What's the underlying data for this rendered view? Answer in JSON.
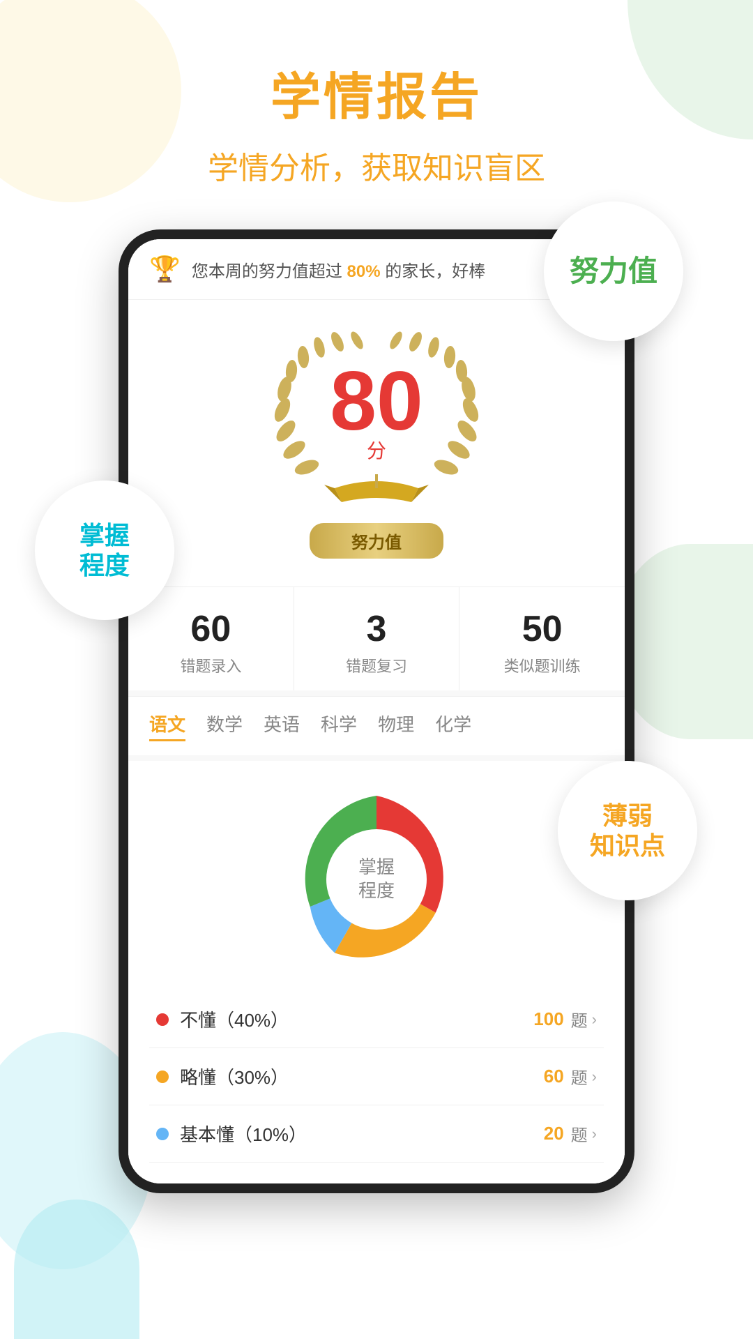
{
  "header": {
    "title": "学情报告",
    "subtitle": "学情分析，获取知识盲区"
  },
  "trophy_banner": {
    "icon": "🏆",
    "text_before": "您本周的努力值超过",
    "highlight": "80%",
    "text_after": "的家长，好棒"
  },
  "score": {
    "number": "80",
    "unit": "分",
    "label": "努力值"
  },
  "stats": [
    {
      "number": "60",
      "label": "错题录入"
    },
    {
      "number": "3",
      "label": "错题复习"
    },
    {
      "number": "50",
      "label": "类似题训练"
    }
  ],
  "subjects": [
    {
      "label": "语文",
      "active": true
    },
    {
      "label": "数学",
      "active": false
    },
    {
      "label": "英语",
      "active": false
    },
    {
      "label": "科学",
      "active": false
    },
    {
      "label": "物理",
      "active": false
    },
    {
      "label": "化学",
      "active": false
    }
  ],
  "chart": {
    "center_label": "掌握\n程度",
    "segments": [
      {
        "label": "不懂",
        "percent": 40,
        "color": "#e53935"
      },
      {
        "label": "略懂",
        "percent": 30,
        "color": "#f5a623"
      },
      {
        "label": "基本懂",
        "percent": 10,
        "color": "#64b5f6"
      },
      {
        "label": "掌握",
        "percent": 20,
        "color": "#4caf50"
      }
    ]
  },
  "legend": [
    {
      "label": "不懂（40%）",
      "color": "#e53935",
      "count": "100",
      "unit": "题"
    },
    {
      "label": "略懂（30%）",
      "color": "#f5a623",
      "count": "60",
      "unit": "题"
    },
    {
      "label": "基本懂（10%）",
      "color": "#64b5f6",
      "count": "20",
      "unit": "题"
    }
  ],
  "badges": {
    "effort": "努力值",
    "mastery": "掌握\n程度",
    "weak_points": "薄弱\n知识点"
  }
}
